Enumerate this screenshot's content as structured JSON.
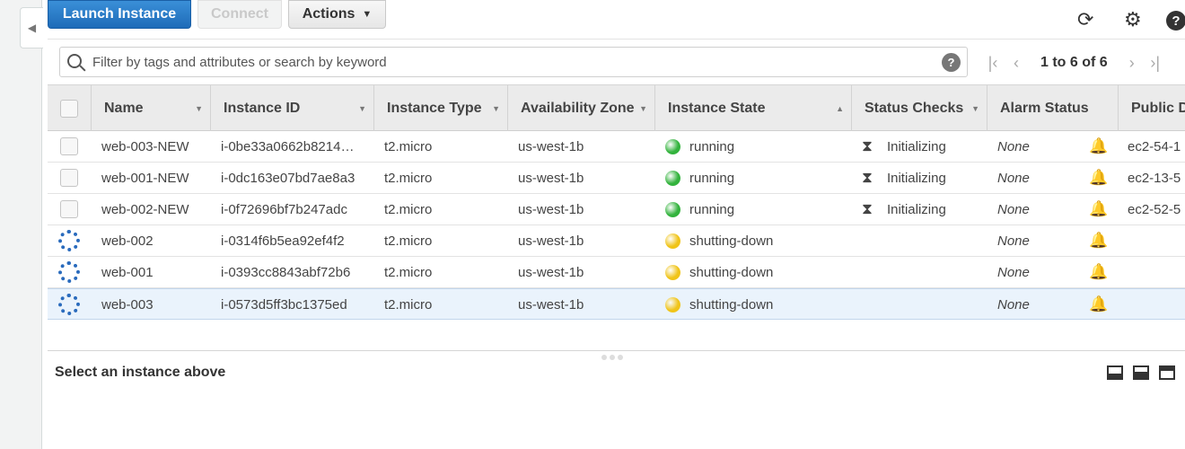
{
  "toolbar": {
    "launch_label": "Launch Instance",
    "connect_label": "Connect",
    "actions_label": "Actions",
    "refresh_icon": "refresh-icon",
    "settings_icon": "gear-icon",
    "help_icon": "help-icon",
    "help_glyph": "?"
  },
  "search": {
    "placeholder": "Filter by tags and attributes or search by keyword",
    "help_glyph": "?"
  },
  "pager": {
    "text": "1 to 6 of 6"
  },
  "table": {
    "headers": {
      "name": "Name",
      "instance_id": "Instance ID",
      "instance_type": "Instance Type",
      "availability_zone": "Availability Zone",
      "instance_state": "Instance State",
      "status_checks": "Status Checks",
      "alarm_status": "Alarm Status",
      "public_dns": "Public D"
    },
    "rows": [
      {
        "name": "web-003-NEW",
        "instance_id": "i-0be33a0662b8214…",
        "type": "t2.micro",
        "zone": "us-west-1b",
        "state": "running",
        "status": "Initializing",
        "alarm": "None",
        "dns": "ec2-54-1"
      },
      {
        "name": "web-001-NEW",
        "instance_id": "i-0dc163e07bd7ae8a3",
        "type": "t2.micro",
        "zone": "us-west-1b",
        "state": "running",
        "status": "Initializing",
        "alarm": "None",
        "dns": "ec2-13-5"
      },
      {
        "name": "web-002-NEW",
        "instance_id": "i-0f72696bf7b247adc",
        "type": "t2.micro",
        "zone": "us-west-1b",
        "state": "running",
        "status": "Initializing",
        "alarm": "None",
        "dns": "ec2-52-5"
      },
      {
        "name": "web-002",
        "instance_id": "i-0314f6b5ea92ef4f2",
        "type": "t2.micro",
        "zone": "us-west-1b",
        "state": "shutting-down",
        "status": "",
        "alarm": "None",
        "dns": ""
      },
      {
        "name": "web-001",
        "instance_id": "i-0393cc8843abf72b6",
        "type": "t2.micro",
        "zone": "us-west-1b",
        "state": "shutting-down",
        "status": "",
        "alarm": "None",
        "dns": ""
      },
      {
        "name": "web-003",
        "instance_id": "i-0573d5ff3bc1375ed",
        "type": "t2.micro",
        "zone": "us-west-1b",
        "state": "shutting-down",
        "status": "",
        "alarm": "None",
        "dns": ""
      }
    ]
  },
  "details": {
    "empty_text": "Select an instance above"
  },
  "colors": {
    "primary": "#1e6bb8",
    "running": "#33b33d",
    "shutting_down": "#f0c419",
    "selected_row": "#eaf3fc"
  }
}
